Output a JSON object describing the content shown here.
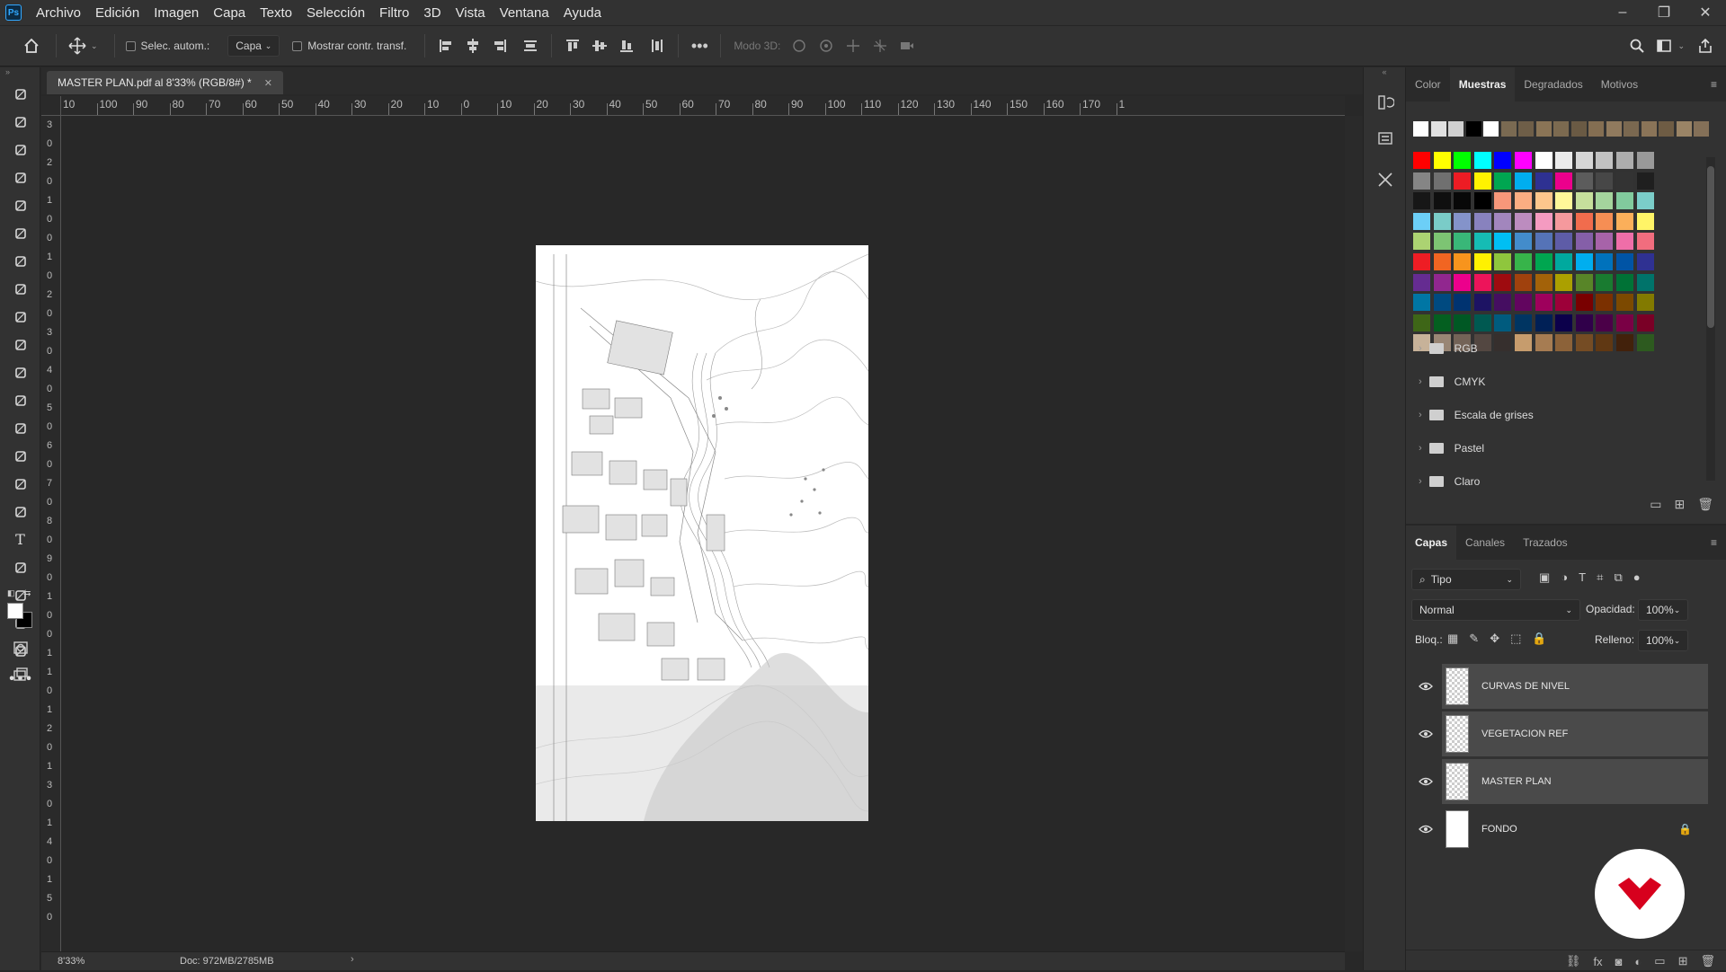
{
  "menu": {
    "app_icon": "Ps",
    "items": [
      "Archivo",
      "Edición",
      "Imagen",
      "Capa",
      "Texto",
      "Selección",
      "Filtro",
      "3D",
      "Vista",
      "Ventana",
      "Ayuda"
    ]
  },
  "window_controls": {
    "minimize": "–",
    "restore": "❐",
    "close": "✕"
  },
  "options_bar": {
    "auto_select_label": "Selec. autom.:",
    "auto_select_value": "Capa",
    "show_transform_label": "Mostrar contr. transf.",
    "mode_3d_label": "Modo 3D:"
  },
  "document": {
    "tab_title": "MASTER PLAN.pdf al 8'33% (RGB/8#) *",
    "zoom": "8'33%",
    "doc_info": "Doc: 972MB/2785MB"
  },
  "ruler": {
    "top_labels": [
      "10",
      "100",
      "90",
      "80",
      "70",
      "60",
      "50",
      "40",
      "30",
      "20",
      "10",
      "0",
      "10",
      "20",
      "30",
      "40",
      "50",
      "60",
      "70",
      "80",
      "90",
      "100",
      "110",
      "120",
      "130",
      "140",
      "150",
      "160",
      "170",
      "1"
    ],
    "left_labels": [
      "3",
      "0",
      "2",
      "0",
      "1",
      "0",
      "0",
      "1",
      "0",
      "2",
      "0",
      "3",
      "0",
      "4",
      "0",
      "5",
      "0",
      "6",
      "0",
      "7",
      "0",
      "8",
      "0",
      "9",
      "0",
      "1",
      "0",
      "0",
      "1",
      "1",
      "0",
      "1",
      "2",
      "0",
      "1",
      "3",
      "0",
      "1",
      "4",
      "0",
      "1",
      "5",
      "0"
    ]
  },
  "swatches_panel": {
    "tabs": [
      "Color",
      "Muestras",
      "Degradados",
      "Motivos"
    ],
    "active_tab": "Muestras",
    "folders": [
      "RGB",
      "CMYK",
      "Escala de grises",
      "Pastel",
      "Claro"
    ],
    "recent_colors": [
      "#ffffff",
      "#e0e0e0",
      "#d0d0d0",
      "#000000",
      "#ffffff",
      "#7a6a52",
      "#6e5e48",
      "#8a7456",
      "#7c6a50",
      "#6a5a44",
      "#846e52",
      "#907a5e",
      "#7a6850",
      "#8a7458",
      "#6e5c44",
      "#9a8466",
      "#847058"
    ],
    "grid_colors": [
      [
        "#ff0000",
        "#ffff00",
        "#00ff00",
        "#00ffff",
        "#0000ff",
        "#ff00ff",
        "#ffffff",
        "#ebebeb",
        "#d6d6d6",
        "#c2c2c2",
        "#adadad",
        "#999999"
      ],
      [
        "#858585",
        "#707070",
        "#ed1c24",
        "#fff200",
        "#00a651",
        "#00aeef",
        "#2e3192",
        "#ec008c",
        "#5c5c5c",
        "#474747",
        "#333333",
        "#1f1f1f"
      ],
      [
        "#171717",
        "#0f0f0f",
        "#080808",
        "#000000",
        "#f7977a",
        "#fbad82",
        "#fdc68c",
        "#fff799",
        "#c6df9c",
        "#a4d49d",
        "#81ca9d",
        "#7bcdc9"
      ],
      [
        "#6ccff7",
        "#7accc8",
        "#8493ca",
        "#8882be",
        "#a286bd",
        "#bc8cbf",
        "#f49bc1",
        "#f5999d",
        "#f16c4d",
        "#f68e54",
        "#fbaf5a",
        "#fff467"
      ],
      [
        "#acd372",
        "#7dc473",
        "#39b778",
        "#16bcb4",
        "#00bff3",
        "#438ccb",
        "#5573b7",
        "#5e5ca7",
        "#855fa8",
        "#a763a9",
        "#ef6ea8",
        "#f16d7e"
      ],
      [
        "#ee1d24",
        "#f16522",
        "#f7941d",
        "#fff100",
        "#8fc63d",
        "#37b44a",
        "#00a650",
        "#00a99e",
        "#00aeef",
        "#0072bc",
        "#0054a5",
        "#2f3192"
      ],
      [
        "#652c91",
        "#91278f",
        "#ec008c",
        "#ed145a",
        "#9e0b0f",
        "#a0410d",
        "#a36209",
        "#aba000",
        "#588528",
        "#197b30",
        "#007236",
        "#00736a"
      ],
      [
        "#0076a4",
        "#004a80",
        "#003370",
        "#1d1363",
        "#450e61",
        "#62055f",
        "#9e005c",
        "#9d0039",
        "#790000",
        "#7b3000",
        "#7c4900",
        "#827a00"
      ],
      [
        "#3e6617",
        "#045f20",
        "#005824",
        "#005951",
        "#005b7e",
        "#003562",
        "#002056",
        "#0c004b",
        "#30004a",
        "#4b0048",
        "#7a0045",
        "#7a0026"
      ],
      [
        "#c7b299",
        "#998675",
        "#736357",
        "#534741",
        "#362f2d",
        "#c69c6d",
        "#a67c52",
        "#8c6239",
        "#754c24",
        "#603813",
        "#42210b",
        "#2d5a1f"
      ]
    ]
  },
  "layers_panel": {
    "tabs": [
      "Capas",
      "Canales",
      "Trazados"
    ],
    "active_tab": "Capas",
    "filter_label": "Tipo",
    "blend_mode": "Normal",
    "opacity_label": "Opacidad:",
    "opacity_value": "100%",
    "lock_label": "Bloq.:",
    "fill_label": "Relleno:",
    "fill_value": "100%",
    "layers": [
      {
        "name": "CURVAS DE NIVEL",
        "selected": true
      },
      {
        "name": "VEGETACION REF",
        "selected": true
      },
      {
        "name": "MASTER PLAN",
        "selected": true
      },
      {
        "name": "FONDO",
        "selected": false,
        "locked": true
      }
    ]
  },
  "colors": {
    "app_bg": "#323232",
    "canvas_bg": "#282828",
    "accent": "#31a8ff",
    "logo_red": "#d7001d"
  }
}
